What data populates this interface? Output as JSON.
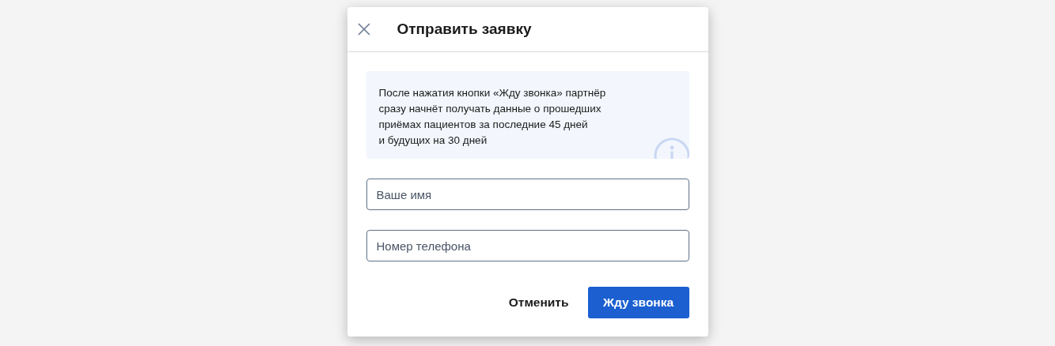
{
  "dialog": {
    "title": "Отправить заявку",
    "info": "После нажатия кнопки «Жду звонка» партнёр\nсразу начнёт получать данные о прошедших\nприёмах пациентов за последние 45 дней\nи будущих на 30 дней",
    "fields": [
      {
        "placeholder": "Ваше имя"
      },
      {
        "placeholder": "Номер телефона"
      }
    ],
    "buttons": [
      {
        "label": "Отменить",
        "kind": "secondary"
      },
      {
        "label": "Жду звонка",
        "kind": "primary"
      }
    ]
  }
}
